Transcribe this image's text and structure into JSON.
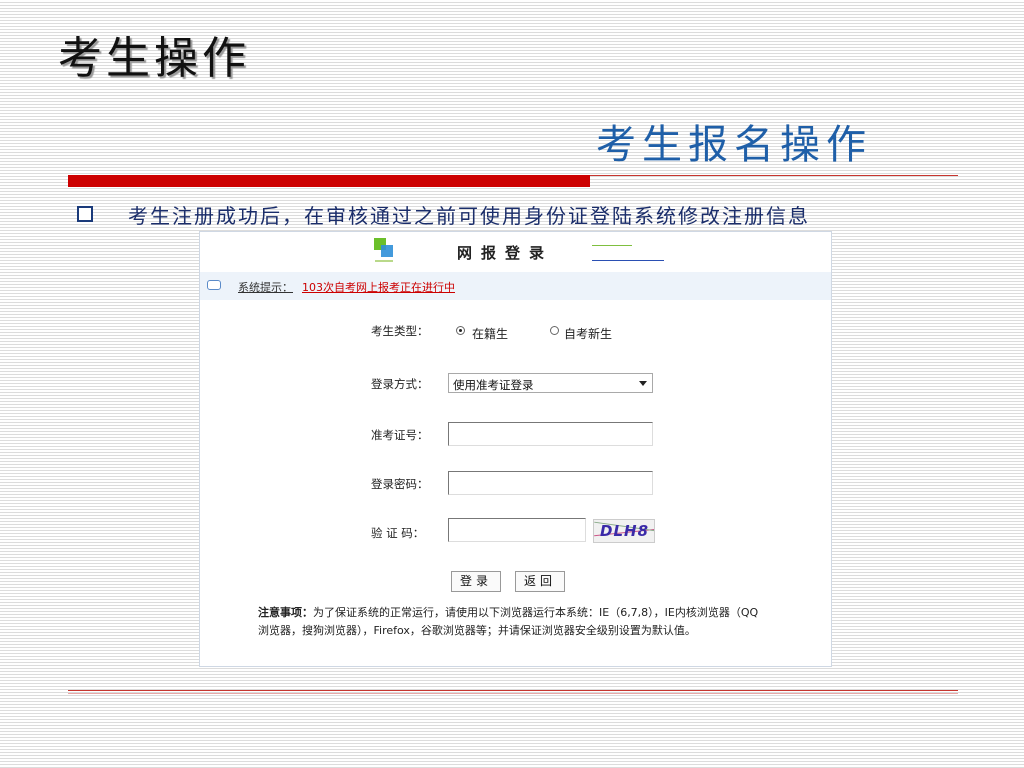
{
  "slide": {
    "title": "考生操作",
    "subtitle": "考生报名操作",
    "bullet": "考生注册成功后，在审核通过之前可使用身份证登陆系统修改注册信息"
  },
  "login": {
    "title": "网报登录",
    "notice_label": "系统提示：",
    "notice_text": "103次自考网上报考正在进行中",
    "candidate_type_label": "考生类型：",
    "candidate_type_options": [
      "在籍生",
      "自考新生"
    ],
    "candidate_type_selected": "在籍生",
    "login_method_label": "登录方式：",
    "login_method_value": "使用准考证登录",
    "ticket_label": "准考证号：",
    "ticket_value": "",
    "password_label": "登录密码：",
    "password_value": "",
    "captcha_label": "验 证 码：",
    "captcha_value": "",
    "captcha_image_text": "DLH8",
    "login_button": "登录",
    "back_button": "返回",
    "notes_title": "注意事项：",
    "notes_text": "为了保证系统的正常运行，请使用以下浏览器运行本系统：IE（6,7,8），IE内核浏览器（QQ浏览器，搜狗浏览器），Firefox，谷歌浏览器等；并请保证浏览器安全级别设置为默认值。"
  },
  "colors": {
    "accent_red": "#cc0000",
    "subtitle_blue": "#1f5fa8",
    "bullet_text": "#1a2d6a"
  }
}
